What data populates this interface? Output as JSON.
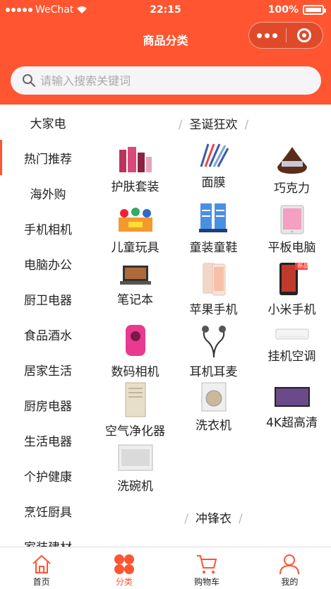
{
  "status_bar": {
    "carrier": "WeChat",
    "time": "22:15",
    "battery": "100%"
  },
  "nav": {
    "title": "商品分类"
  },
  "search": {
    "placeholder": "请输入搜索关键词"
  },
  "sidebar": {
    "items": [
      {
        "label": "大家电"
      },
      {
        "label": "热门推荐",
        "active": true
      },
      {
        "label": "海外购"
      },
      {
        "label": "手机相机"
      },
      {
        "label": "电脑办公"
      },
      {
        "label": "厨卫电器"
      },
      {
        "label": "食品酒水"
      },
      {
        "label": "居家生活"
      },
      {
        "label": "厨房电器"
      },
      {
        "label": "生活电器"
      },
      {
        "label": "个护健康"
      },
      {
        "label": "烹饪厨具"
      },
      {
        "label": "家装建材"
      }
    ]
  },
  "content": {
    "sections": [
      {
        "title": "圣诞狂欢",
        "items": [
          {
            "label": "护肤套装"
          },
          {
            "label": "面膜"
          },
          {
            "label": "巧克力"
          },
          {
            "label": "儿童玩具"
          },
          {
            "label": "童装童鞋"
          },
          {
            "label": "平板电脑"
          },
          {
            "label": "笔记本"
          },
          {
            "label": "苹果手机"
          },
          {
            "label": "小米手机",
            "badge": "新品"
          },
          {
            "label": "数码相机"
          },
          {
            "label": "耳机耳麦"
          },
          {
            "label": "挂机空调"
          },
          {
            "label": "空气净化器"
          },
          {
            "label": "洗衣机"
          },
          {
            "label": "4K超高清"
          },
          {
            "label": "洗碗机"
          }
        ]
      },
      {
        "title": "冲锋衣",
        "items": []
      }
    ]
  },
  "tabbar": {
    "items": [
      {
        "label": "首页",
        "icon": "home-icon"
      },
      {
        "label": "分类",
        "icon": "category-icon",
        "active": true
      },
      {
        "label": "购物车",
        "icon": "cart-icon"
      },
      {
        "label": "我的",
        "icon": "user-icon"
      }
    ]
  },
  "colors": {
    "brand": "#ff5530",
    "tab_active": "#ff5530"
  }
}
